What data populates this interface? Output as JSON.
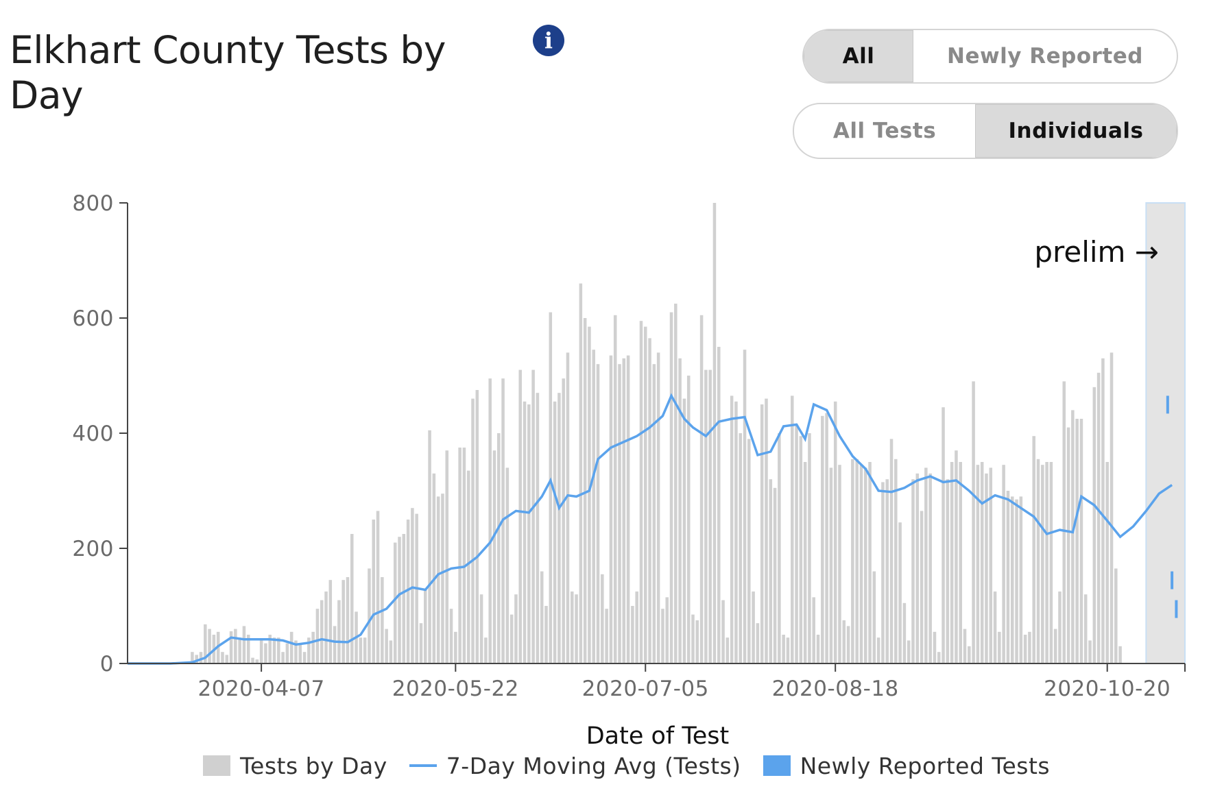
{
  "header": {
    "title": "Elkhart County Tests by Day",
    "info_icon": "info-icon",
    "info_glyph": "i"
  },
  "toggles": {
    "report_mode": {
      "options": [
        "All",
        "Newly Reported"
      ],
      "selected": "All"
    },
    "count_mode": {
      "options": [
        "All Tests",
        "Individuals"
      ],
      "selected": "Individuals"
    }
  },
  "colors": {
    "bars": "#d0d0d0",
    "moving_avg": "#5ba3ec",
    "newly_reported": "#5ba3ec",
    "prelim_band": "#e4e4e4"
  },
  "chart_data": {
    "type": "bar",
    "x_start": "2020-03-07",
    "x_end": "2020-11-04",
    "xlabel": "Date of Test",
    "ylabel": "",
    "ylim": [
      0,
      800
    ],
    "y_ticks": [
      "0",
      "200",
      "400",
      "600",
      "800"
    ],
    "x_ticks": [
      "2020-04-07",
      "2020-05-22",
      "2020-07-05",
      "2020-08-18",
      "2020-10-20"
    ],
    "annotation": "prelim →",
    "prelim_from": "2020-10-29",
    "legend": [
      "Tests by Day",
      "7-Day Moving Avg (Tests)",
      "Newly Reported Tests"
    ],
    "series": [
      {
        "name": "Tests by Day",
        "type": "bar",
        "start": "2020-03-07",
        "values": [
          0,
          0,
          0,
          0,
          0,
          0,
          0,
          0,
          0,
          0,
          0,
          0,
          0,
          0,
          0,
          20,
          15,
          20,
          68,
          60,
          50,
          55,
          20,
          15,
          56,
          60,
          45,
          65,
          50,
          10,
          7,
          40,
          35,
          50,
          45,
          45,
          20,
          35,
          55,
          40,
          35,
          20,
          45,
          55,
          95,
          110,
          125,
          145,
          65,
          110,
          145,
          150,
          225,
          90,
          45,
          45,
          165,
          250,
          265,
          150,
          60,
          40,
          210,
          220,
          225,
          250,
          270,
          260,
          70,
          130,
          405,
          330,
          290,
          295,
          370,
          95,
          55,
          375,
          375,
          335,
          460,
          475,
          120,
          45,
          495,
          370,
          400,
          495,
          340,
          85,
          120,
          510,
          455,
          450,
          510,
          470,
          160,
          100,
          610,
          455,
          470,
          495,
          540,
          125,
          120,
          660,
          600,
          585,
          545,
          520,
          155,
          95,
          535,
          605,
          520,
          530,
          535,
          100,
          125,
          595,
          585,
          565,
          520,
          540,
          95,
          115,
          610,
          625,
          530,
          460,
          500,
          85,
          75,
          605,
          510,
          510,
          800,
          550,
          110,
          45,
          465,
          455,
          400,
          545,
          390,
          125,
          70,
          450,
          460,
          320,
          305,
          400,
          50,
          45,
          465,
          415,
          395,
          350,
          400,
          115,
          50,
          430,
          435,
          340,
          455,
          345,
          75,
          65,
          355,
          355,
          345,
          340,
          350,
          160,
          45,
          315,
          320,
          390,
          355,
          245,
          105,
          40,
          320,
          330,
          265,
          340,
          330,
          55,
          20,
          445,
          320,
          350,
          370,
          350,
          60,
          30,
          490,
          345,
          350,
          330,
          340,
          125,
          55,
          345,
          300,
          290,
          285,
          290,
          50,
          55,
          395,
          355,
          345,
          350,
          350,
          60,
          125,
          490,
          410,
          440,
          425,
          425,
          120,
          40,
          480,
          505,
          530,
          350,
          540,
          165,
          30
        ]
      },
      {
        "name": "7-Day Moving Avg (Tests)",
        "type": "line",
        "points": [
          [
            "2020-03-07",
            0
          ],
          [
            "2020-03-17",
            0
          ],
          [
            "2020-03-22",
            2
          ],
          [
            "2020-03-25",
            10
          ],
          [
            "2020-03-28",
            30
          ],
          [
            "2020-03-31",
            45
          ],
          [
            "2020-04-03",
            42
          ],
          [
            "2020-04-06",
            42
          ],
          [
            "2020-04-09",
            42
          ],
          [
            "2020-04-12",
            40
          ],
          [
            "2020-04-15",
            33
          ],
          [
            "2020-04-18",
            36
          ],
          [
            "2020-04-21",
            42
          ],
          [
            "2020-04-24",
            38
          ],
          [
            "2020-04-27",
            37
          ],
          [
            "2020-04-30",
            50
          ],
          [
            "2020-05-03",
            85
          ],
          [
            "2020-05-06",
            95
          ],
          [
            "2020-05-09",
            120
          ],
          [
            "2020-05-12",
            132
          ],
          [
            "2020-05-15",
            128
          ],
          [
            "2020-05-18",
            155
          ],
          [
            "2020-05-21",
            165
          ],
          [
            "2020-05-24",
            168
          ],
          [
            "2020-05-27",
            185
          ],
          [
            "2020-05-30",
            210
          ],
          [
            "2020-06-02",
            250
          ],
          [
            "2020-06-05",
            265
          ],
          [
            "2020-06-08",
            262
          ],
          [
            "2020-06-11",
            290
          ],
          [
            "2020-06-13",
            318
          ],
          [
            "2020-06-15",
            270
          ],
          [
            "2020-06-17",
            292
          ],
          [
            "2020-06-19",
            290
          ],
          [
            "2020-06-22",
            300
          ],
          [
            "2020-06-24",
            355
          ],
          [
            "2020-06-27",
            375
          ],
          [
            "2020-06-30",
            385
          ],
          [
            "2020-07-03",
            395
          ],
          [
            "2020-07-06",
            410
          ],
          [
            "2020-07-09",
            430
          ],
          [
            "2020-07-11",
            465
          ],
          [
            "2020-07-14",
            425
          ],
          [
            "2020-07-16",
            410
          ],
          [
            "2020-07-19",
            395
          ],
          [
            "2020-07-22",
            420
          ],
          [
            "2020-07-25",
            425
          ],
          [
            "2020-07-28",
            428
          ],
          [
            "2020-07-31",
            362
          ],
          [
            "2020-08-03",
            368
          ],
          [
            "2020-08-06",
            412
          ],
          [
            "2020-08-09",
            415
          ],
          [
            "2020-08-11",
            390
          ],
          [
            "2020-08-13",
            450
          ],
          [
            "2020-08-16",
            440
          ],
          [
            "2020-08-19",
            395
          ],
          [
            "2020-08-22",
            360
          ],
          [
            "2020-08-25",
            338
          ],
          [
            "2020-08-28",
            300
          ],
          [
            "2020-08-31",
            298
          ],
          [
            "2020-09-03",
            305
          ],
          [
            "2020-09-06",
            318
          ],
          [
            "2020-09-09",
            325
          ],
          [
            "2020-09-12",
            315
          ],
          [
            "2020-09-15",
            318
          ],
          [
            "2020-09-18",
            300
          ],
          [
            "2020-09-21",
            278
          ],
          [
            "2020-09-24",
            292
          ],
          [
            "2020-09-27",
            285
          ],
          [
            "2020-09-30",
            270
          ],
          [
            "2020-10-03",
            255
          ],
          [
            "2020-10-06",
            225
          ],
          [
            "2020-10-09",
            232
          ],
          [
            "2020-10-12",
            228
          ],
          [
            "2020-10-14",
            290
          ],
          [
            "2020-10-17",
            275
          ],
          [
            "2020-10-20",
            248
          ],
          [
            "2020-10-23",
            220
          ],
          [
            "2020-10-26",
            238
          ],
          [
            "2020-10-29",
            265
          ],
          [
            "2020-11-01",
            295
          ],
          [
            "2020-11-04",
            310
          ]
        ]
      },
      {
        "name": "Newly Reported Tests",
        "type": "bar",
        "points": [
          [
            "2020-11-03",
            465
          ],
          [
            "2020-11-04",
            160
          ],
          [
            "2020-11-05",
            110
          ]
        ]
      }
    ]
  },
  "legend_labels": {
    "bars": "Tests by Day",
    "line": "7-Day Moving Avg (Tests)",
    "new": "Newly Reported Tests"
  }
}
